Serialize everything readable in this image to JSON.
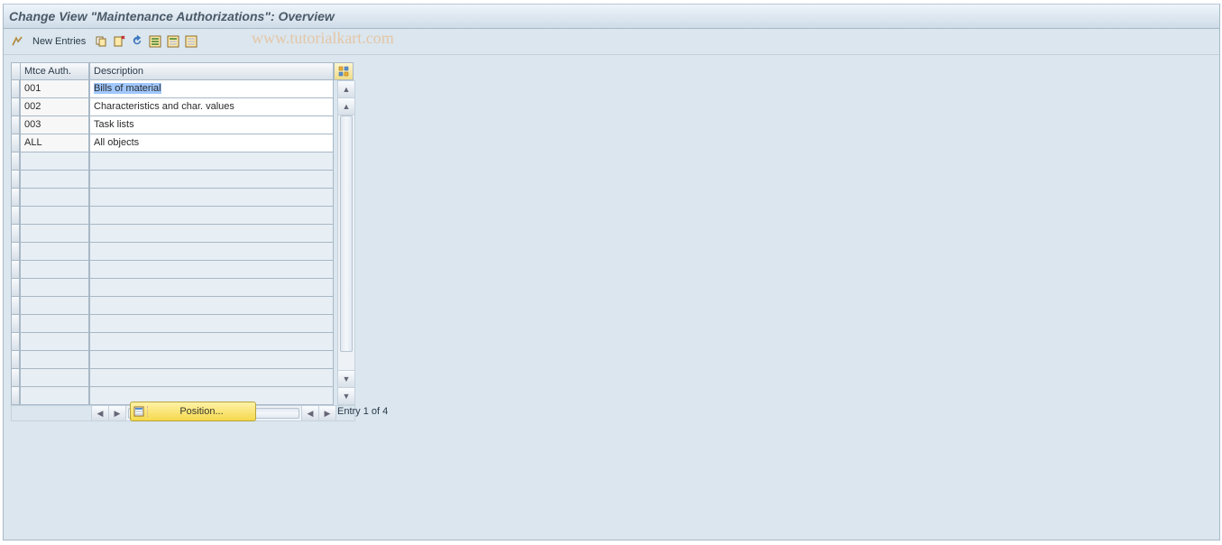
{
  "title": "Change View \"Maintenance Authorizations\": Overview",
  "toolbar": {
    "new_entries_label": "New Entries"
  },
  "watermark": "www.tutorialkart.com",
  "table": {
    "columns": {
      "code": "Mtce Auth.",
      "desc": "Description"
    },
    "rows": [
      {
        "code": "001",
        "desc": "Bills of material",
        "selected": true
      },
      {
        "code": "002",
        "desc": "Characteristics and char. values",
        "selected": false
      },
      {
        "code": "003",
        "desc": "Task lists",
        "selected": false
      },
      {
        "code": "ALL",
        "desc": "All objects",
        "selected": false
      }
    ],
    "empty_rows_after": 14
  },
  "footer": {
    "position_label": "Position...",
    "entry_text": "Entry 1 of 4"
  }
}
